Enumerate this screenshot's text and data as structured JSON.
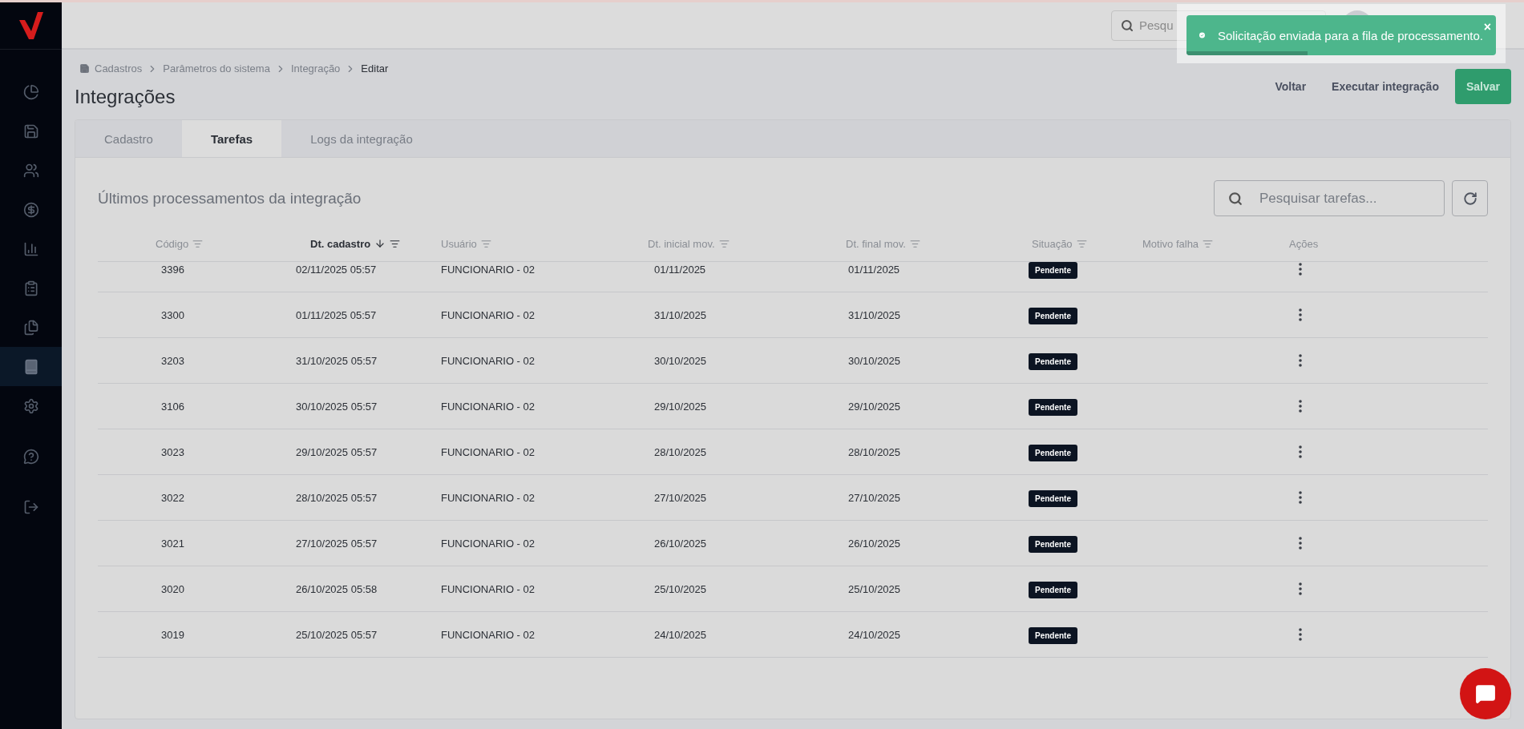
{
  "sidebar": {
    "items": [
      {
        "selected": false
      },
      {
        "selected": false
      },
      {
        "selected": false
      },
      {
        "selected": false
      },
      {
        "selected": false
      },
      {
        "selected": false
      },
      {
        "selected": false
      },
      {
        "selected": true
      },
      {
        "selected": false
      },
      {
        "selected": false
      },
      {
        "selected": false
      }
    ]
  },
  "header": {
    "search": {
      "placeholder": "Pesqu"
    }
  },
  "toast": {
    "message": "Solicitação enviada para a fila de processamento.",
    "close": "×",
    "level": 0.39
  },
  "breadcrumb": [
    "Cadastros",
    "Parâmetros do sistema",
    "Integração",
    "Editar"
  ],
  "title": "Integrações",
  "actions": [
    {
      "label": "Voltar",
      "kind": "link"
    },
    {
      "label": "Executar integração",
      "kind": "link"
    },
    {
      "label": "Salvar",
      "kind": "primary"
    }
  ],
  "tabs": [
    {
      "label": "Cadastro",
      "selected": false
    },
    {
      "label": "Tarefas",
      "selected": true
    },
    {
      "label": "Logs da integração",
      "selected": false
    }
  ],
  "section_title": "Últimos processamentos da integração",
  "table_search": {
    "placeholder": "Pesquisar tarefas..."
  },
  "table": {
    "columns": [
      {
        "label": "Código",
        "sorted": false,
        "filterable": true
      },
      {
        "label": "Dt. cadastro",
        "sorted": true,
        "filterable": true
      },
      {
        "label": "Usuário",
        "sorted": false,
        "filterable": true
      },
      {
        "label": "Dt. inicial mov.",
        "sorted": false,
        "filterable": true
      },
      {
        "label": "Dt. final mov.",
        "sorted": false,
        "filterable": true
      },
      {
        "label": "Situação",
        "sorted": false,
        "filterable": true
      },
      {
        "label": "Motivo falha",
        "sorted": false,
        "filterable": true
      },
      {
        "label": "Ações",
        "sorted": false,
        "filterable": false
      }
    ],
    "rows": [
      [
        "3396",
        "02/11/2025 05:57",
        "FUNCIONARIO - 02",
        "01/11/2025",
        "01/11/2025",
        "Pendente"
      ],
      [
        "3300",
        "01/11/2025 05:57",
        "FUNCIONARIO - 02",
        "31/10/2025",
        "31/10/2025",
        "Pendente"
      ],
      [
        "3203",
        "31/10/2025 05:57",
        "FUNCIONARIO - 02",
        "30/10/2025",
        "30/10/2025",
        "Pendente"
      ],
      [
        "3106",
        "30/10/2025 05:57",
        "FUNCIONARIO - 02",
        "29/10/2025",
        "29/10/2025",
        "Pendente"
      ],
      [
        "3023",
        "29/10/2025 05:57",
        "FUNCIONARIO - 02",
        "28/10/2025",
        "28/10/2025",
        "Pendente"
      ],
      [
        "3022",
        "28/10/2025 05:57",
        "FUNCIONARIO - 02",
        "27/10/2025",
        "27/10/2025",
        "Pendente"
      ],
      [
        "3021",
        "27/10/2025 05:57",
        "FUNCIONARIO - 02",
        "26/10/2025",
        "26/10/2025",
        "Pendente"
      ],
      [
        "3020",
        "26/10/2025 05:58",
        "FUNCIONARIO - 02",
        "25/10/2025",
        "25/10/2025",
        "Pendente"
      ],
      [
        "3019",
        "25/10/2025 05:57",
        "FUNCIONARIO - 02",
        "24/10/2025",
        "24/10/2025",
        "Pendente"
      ]
    ]
  }
}
